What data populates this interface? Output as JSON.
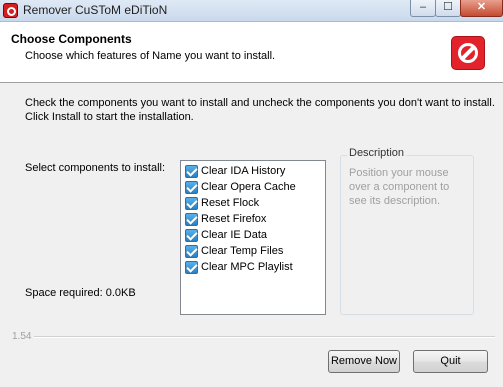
{
  "window": {
    "title": "Remover CuSToM eDiTioN",
    "minimize_label": "–",
    "maximize_label": "☐",
    "close_label": "✕"
  },
  "header": {
    "title": "Choose Components",
    "subtitle": "Choose which features of Name you want to install.",
    "icon": "no-entry-icon"
  },
  "main": {
    "instructions": "Check the components you want to install and uncheck the components you don't want to install. Click Install to start the installation.",
    "select_label": "Select components to install:",
    "space_label": "Space required: 0.0KB",
    "components": [
      {
        "label": "Clear IDA History",
        "checked": true
      },
      {
        "label": "Clear Opera Cache",
        "checked": true
      },
      {
        "label": "Reset Flock",
        "checked": true
      },
      {
        "label": "Reset Firefox",
        "checked": true
      },
      {
        "label": "Clear IE Data",
        "checked": true
      },
      {
        "label": "Clear Temp Files",
        "checked": true
      },
      {
        "label": "Clear MPC Playlist",
        "checked": true
      }
    ],
    "description": {
      "title": "Description",
      "text": "Position your mouse over a component to see its description."
    }
  },
  "footer": {
    "version": "1.54",
    "remove_label": "Remove Now",
    "quit_label": "Quit"
  }
}
